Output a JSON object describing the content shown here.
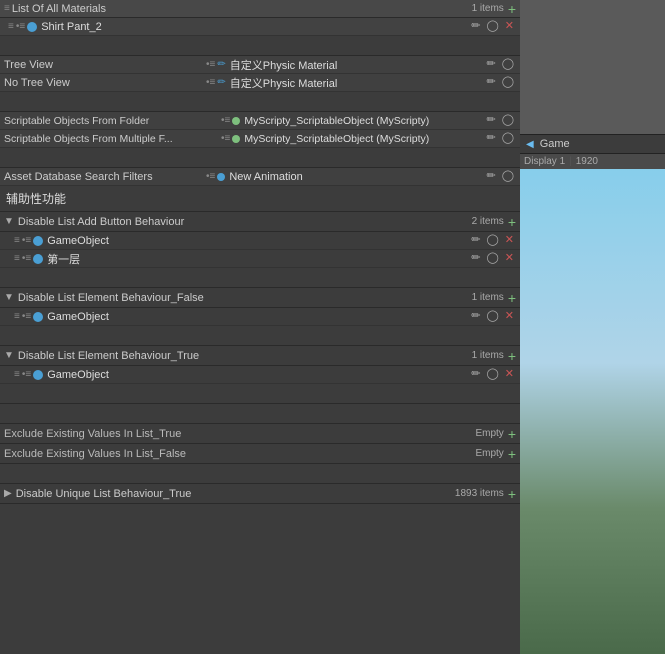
{
  "topListRow": {
    "label": "List Of All Materials",
    "count": "1 items"
  },
  "shirtRow": {
    "icon": "🔵",
    "label": "Shirt Pant_2"
  },
  "treeViewRow": {
    "label": "Tree View",
    "icons": "•≡",
    "valueIcon": "✏",
    "value": "自定义Physic Material"
  },
  "noTreeViewRow": {
    "label": "No Tree View",
    "icons": "•≡",
    "valueIcon": "✏",
    "value": "自定义Physic Material"
  },
  "scriptableObjectsFolder": {
    "label": "Scriptable Objects From Folder",
    "icons": "•≡",
    "value": "MyScripty_ScriptableObject (MyScripty)"
  },
  "scriptableObjectsMultiple": {
    "label": "Scriptable Objects From Multiple F...",
    "icons": "•≡",
    "value": "MyScripty_ScriptableObject (MyScripty)"
  },
  "assetDatabaseRow": {
    "label": "Asset Database Search Filters",
    "icons": "•≡",
    "valueIcon": "🔵",
    "value": "New Animation"
  },
  "auxSection": {
    "label": "辅助性功能"
  },
  "disableListAdd": {
    "title": "Disable List Add Button Behaviour",
    "count": "2 items"
  },
  "gameObjectRow1": {
    "icon": "🔵",
    "label": "GameObject"
  },
  "firstLayerRow": {
    "icon": "🔵",
    "label": "第一层"
  },
  "disableElementFalse": {
    "title": "Disable List Element Behaviour_False",
    "count": "1 items"
  },
  "gameObjectRow2": {
    "icon": "🔵",
    "label": "GameObject"
  },
  "disableElementTrue": {
    "title": "Disable List Element Behaviour_True",
    "count": "1 items"
  },
  "gameObjectRow3": {
    "icon": "🔵",
    "label": "GameObject"
  },
  "excludeTrue": {
    "label": "Exclude Existing Values In List_True",
    "status": "Empty"
  },
  "excludeFalse": {
    "label": "Exclude Existing Values In List_False",
    "status": "Empty"
  },
  "disableUnique": {
    "title": "Disable Unique List Behaviour_True",
    "count": "1893 items"
  },
  "gamePanel": {
    "title": "Game",
    "displayLabel": "Display 1",
    "resolution": "1920"
  }
}
